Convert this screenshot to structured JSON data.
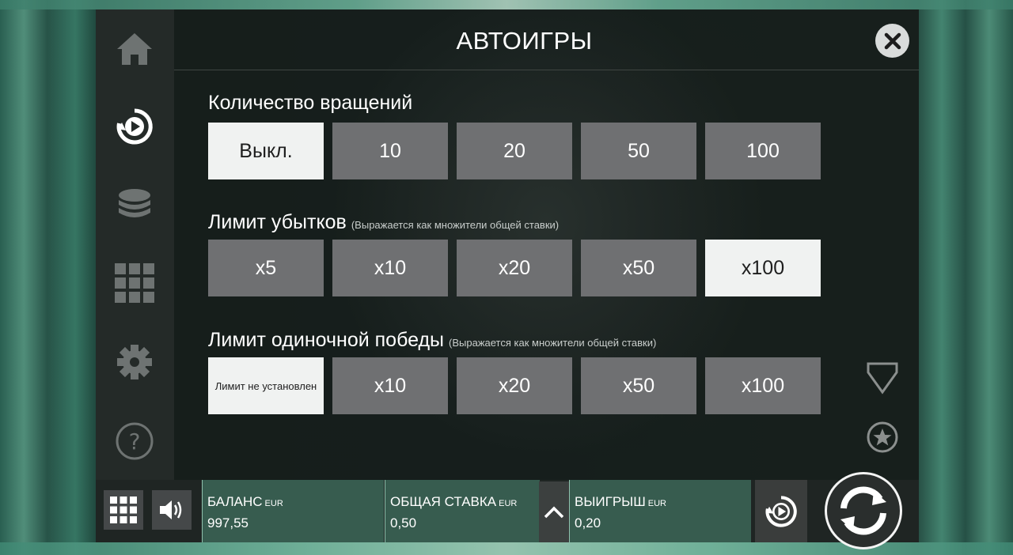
{
  "title": "АВТОИГРЫ",
  "spins": {
    "label": "Количество вращений",
    "options": [
      "Выкл.",
      "10",
      "20",
      "50",
      "100"
    ],
    "selected": "Выкл."
  },
  "loss_limit": {
    "label": "Лимит убытков",
    "hint": "(Выражается как множители общей ставки)",
    "options": [
      "x5",
      "x10",
      "x20",
      "x50",
      "x100"
    ],
    "selected": "x100"
  },
  "win_limit": {
    "label": "Лимит одиночной победы",
    "hint": "(Выражается как множители общей ставки)",
    "options": [
      "Лимит не установлен",
      "x10",
      "x20",
      "x50",
      "x100"
    ],
    "selected": "Лимит не установлен"
  },
  "sidebar": {
    "icons": [
      "home-icon",
      "autoplay-icon",
      "coins-icon",
      "grid-icon",
      "gear-icon",
      "help-icon"
    ],
    "active": "autoplay-icon"
  },
  "right_icons": [
    "shield-icon",
    "star-icon"
  ],
  "bottom_bar": {
    "balance": {
      "label": "БАЛАНС",
      "currency": "EUR",
      "value": "997,55"
    },
    "total_bet": {
      "label": "ОБЩАЯ СТАВКА",
      "currency": "EUR",
      "value": "0,50"
    },
    "win": {
      "label": "ВЫИГРЫШ",
      "currency": "EUR",
      "value": "0,20"
    }
  },
  "colors": {
    "panel": "#161b19",
    "option": "#6f7072",
    "option_selected": "#f0f2f1",
    "info_bg": "#4a8a74"
  }
}
